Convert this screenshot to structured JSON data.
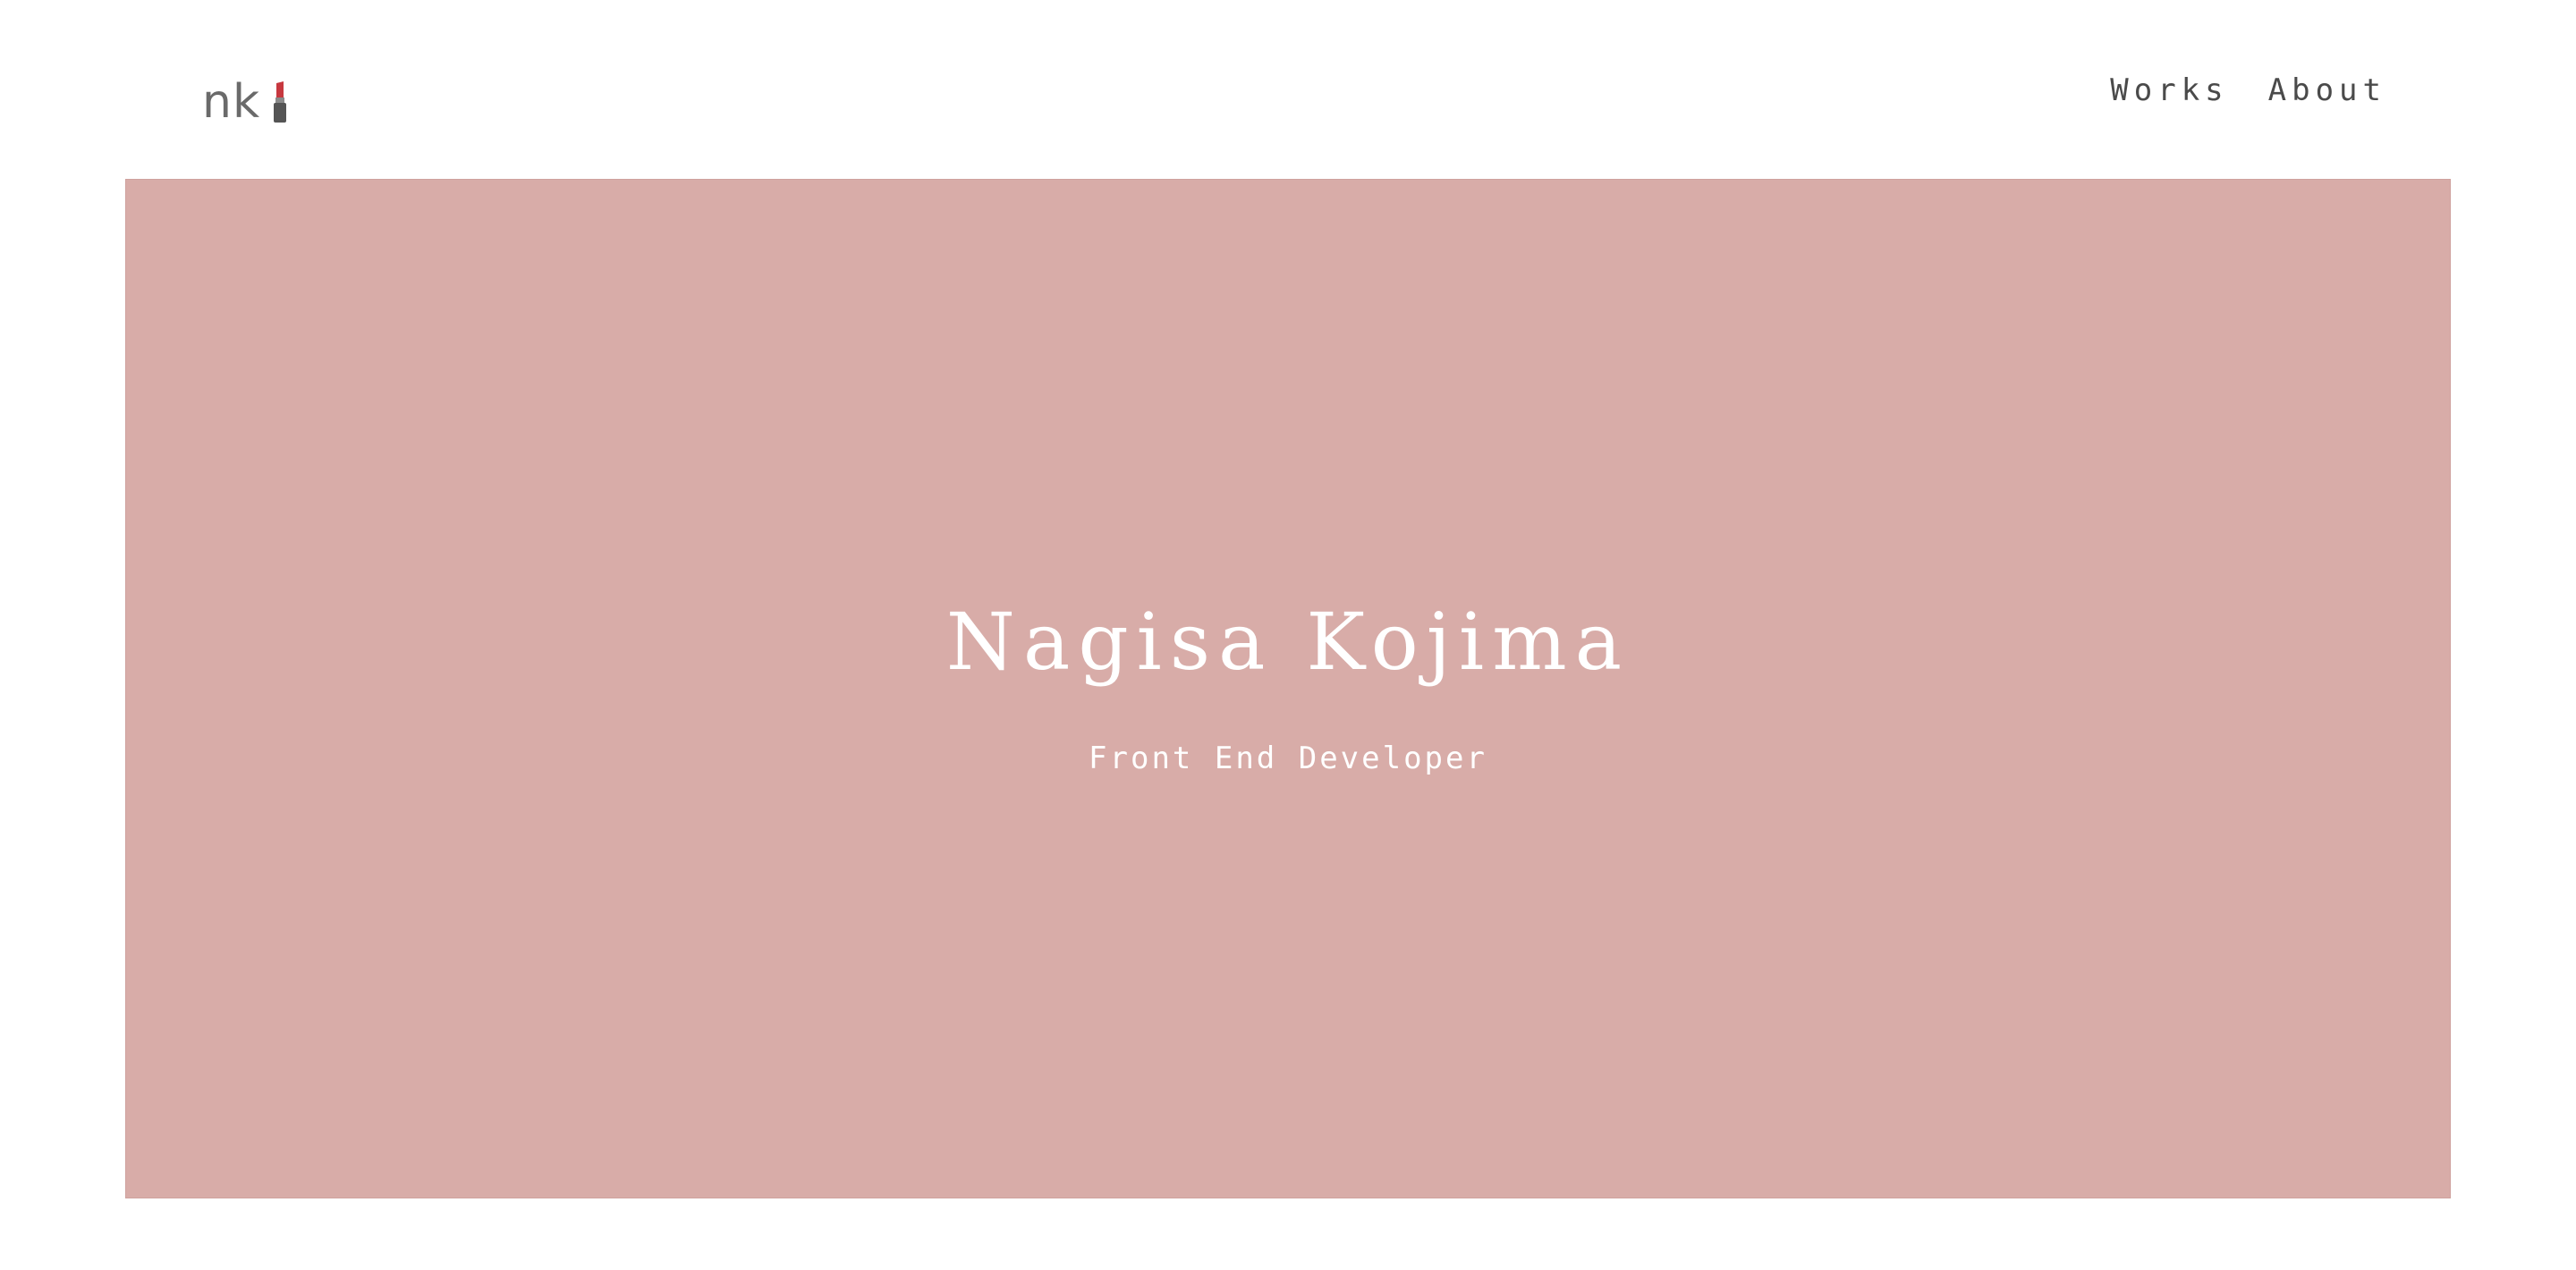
{
  "header": {
    "logo_text": "nk",
    "logo_icon": "lipstick-icon",
    "nav": [
      {
        "label": "Works"
      },
      {
        "label": "About"
      }
    ]
  },
  "hero": {
    "title": "Nagisa Kojima",
    "subtitle": "Front End Developer",
    "background_color": "#d8aca8",
    "text_color": "#ffffff"
  }
}
